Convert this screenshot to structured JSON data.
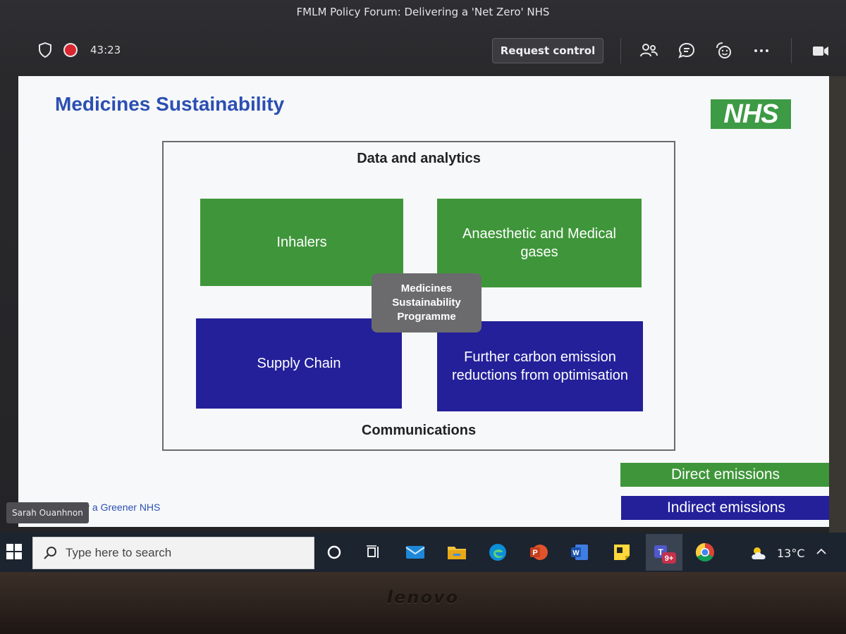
{
  "teams": {
    "meeting_title": "FMLM Policy Forum: Delivering a 'Net Zero' NHS",
    "timer": "43:23",
    "request_control_label": "Request control",
    "participant_name": "Sarah Ouanhnon"
  },
  "slide": {
    "title": "Medicines Sustainability",
    "logo": "NHS",
    "top_label": "Data and analytics",
    "bottom_label": "Communications",
    "center_label": "Medicines Sustainability Programme",
    "boxes": [
      {
        "label": "Inhalers",
        "category": "direct"
      },
      {
        "label": "Anaesthetic and Medical gases",
        "category": "direct"
      },
      {
        "label": "Supply Chain",
        "category": "indirect"
      },
      {
        "label": "Further carbon emission reductions from optimisation",
        "category": "indirect"
      }
    ],
    "legend": {
      "direct": "Direct emissions",
      "indirect": "Indirect emissions"
    },
    "footer": "For a Greener NHS",
    "colors": {
      "direct": "#3f963a",
      "indirect": "#23209a",
      "title": "#2b4fb2"
    }
  },
  "taskbar": {
    "search_placeholder": "Type here to search",
    "apps": [
      "cortana-icon",
      "task-view-icon",
      "mail-icon",
      "file-explorer-icon",
      "edge-icon",
      "powerpoint-icon",
      "word-icon",
      "sticky-notes-icon",
      "teams-icon",
      "chrome-icon"
    ],
    "teams_badge": "9+",
    "temperature": "13°C"
  },
  "device": {
    "brand": "lenovo"
  }
}
